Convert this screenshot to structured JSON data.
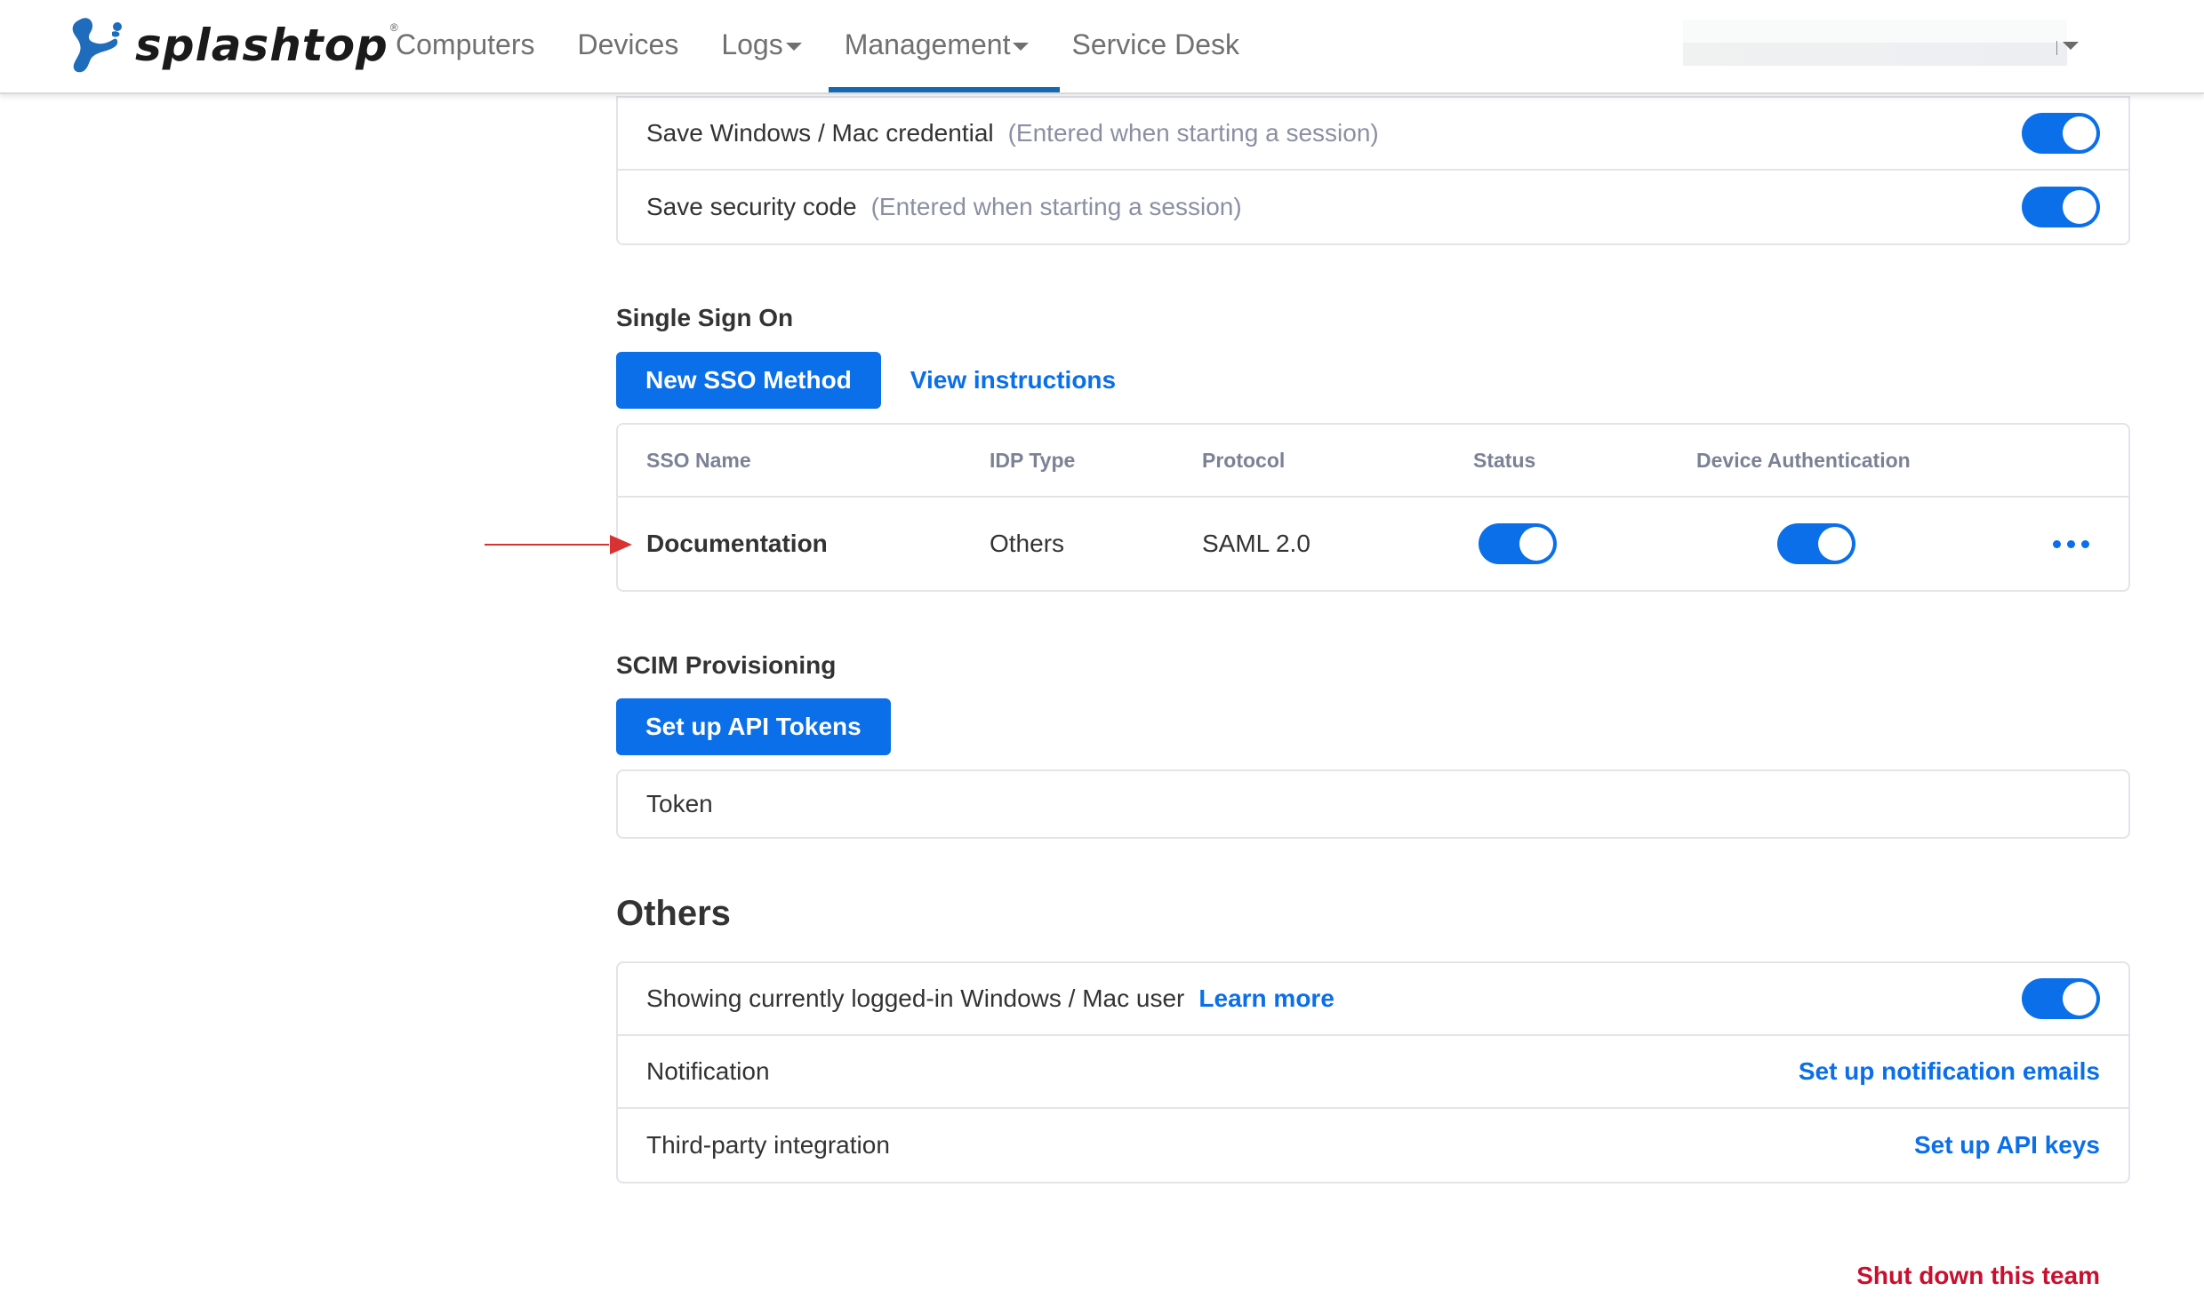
{
  "header": {
    "logo_text": "splashtop",
    "logo_reg": "®",
    "nav": [
      {
        "label": "Computers",
        "has_caret": false,
        "active": false
      },
      {
        "label": "Devices",
        "has_caret": false,
        "active": false
      },
      {
        "label": "Logs",
        "has_caret": true,
        "active": false
      },
      {
        "label": "Management",
        "has_caret": true,
        "active": true
      },
      {
        "label": "Service Desk",
        "has_caret": false,
        "active": false
      }
    ],
    "account_icon": "caret-down-icon"
  },
  "credentials": {
    "rows": [
      {
        "label": "Save Windows / Mac credential",
        "hint": "(Entered when starting a session)",
        "enabled": true
      },
      {
        "label": "Save security code",
        "hint": "(Entered when starting a session)",
        "enabled": true
      }
    ]
  },
  "sso": {
    "title": "Single Sign On",
    "new_button": "New SSO Method",
    "instructions_link": "View instructions",
    "columns": [
      "SSO Name",
      "IDP Type",
      "Protocol",
      "Status",
      "Device Authentication"
    ],
    "rows": [
      {
        "name": "Documentation",
        "idp_type": "Others",
        "protocol": "SAML 2.0",
        "status": true,
        "device_auth": true,
        "menu_icon": "more-horizontal-icon"
      }
    ]
  },
  "scim": {
    "title": "SCIM Provisioning",
    "button": "Set up API Tokens",
    "token_label": "Token"
  },
  "others": {
    "title": "Others",
    "rows": [
      {
        "label": "Showing currently logged-in Windows / Mac user",
        "link": "Learn more",
        "enabled": true
      },
      {
        "label": "Notification",
        "action": "Set up notification emails"
      },
      {
        "label": "Third-party integration",
        "action": "Set up API keys"
      }
    ]
  },
  "danger": {
    "shutdown": "Shut down this team"
  },
  "colors": {
    "accent": "#0a6fe8",
    "nav_active": "#1468b1",
    "danger": "#c8102e",
    "annotation": "#d93232"
  }
}
